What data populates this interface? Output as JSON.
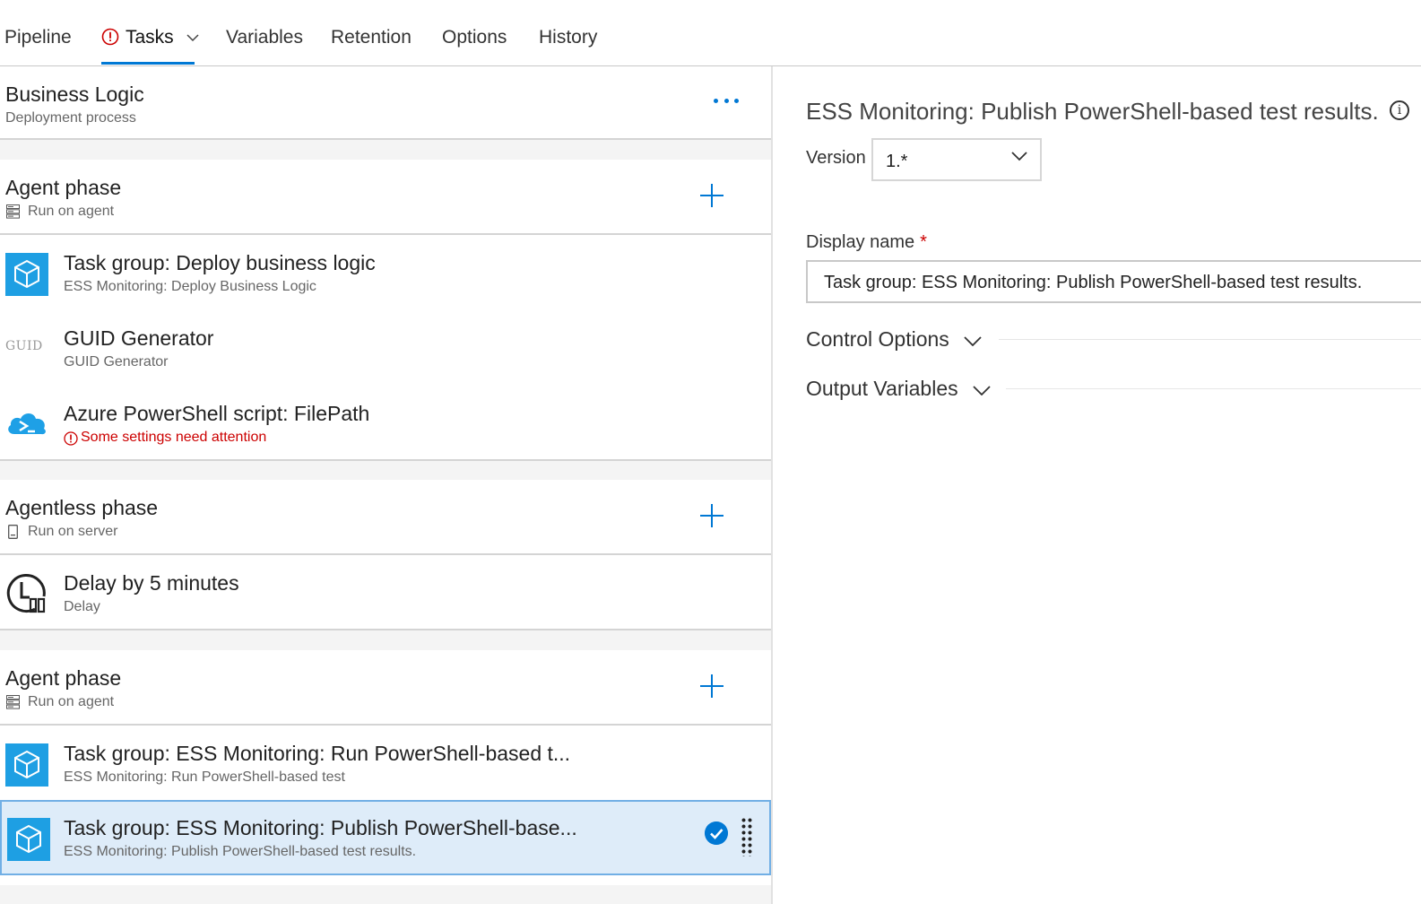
{
  "tabs": {
    "pipeline": "Pipeline",
    "tasks": "Tasks",
    "variables": "Variables",
    "retention": "Retention",
    "options": "Options",
    "history": "History"
  },
  "process": {
    "title": "Business Logic",
    "subtitle": "Deployment process"
  },
  "phases": [
    {
      "title": "Agent phase",
      "subtitle": "Run on agent",
      "tasks": [
        {
          "title": "Task group: Deploy business logic",
          "subtitle": "ESS Monitoring: Deploy Business Logic",
          "icon": "task-group-icon"
        },
        {
          "title": "GUID Generator",
          "subtitle": "GUID Generator",
          "icon": "guid-icon",
          "icon_text": "GUID"
        },
        {
          "title": "Azure PowerShell script: FilePath",
          "subtitle": "Some settings need attention",
          "icon": "azure-powershell-icon"
        }
      ]
    },
    {
      "title": "Agentless phase",
      "subtitle": "Run on server",
      "tasks": [
        {
          "title": "Delay by 5 minutes",
          "subtitle": "Delay",
          "icon": "delay-icon"
        }
      ]
    },
    {
      "title": "Agent phase",
      "subtitle": "Run on agent",
      "tasks": [
        {
          "title": "Task group: ESS Monitoring: Run PowerShell-based t...",
          "subtitle": "ESS Monitoring: Run PowerShell-based test",
          "icon": "task-group-icon"
        },
        {
          "title": "Task group: ESS Monitoring: Publish PowerShell-base...",
          "subtitle": "ESS Monitoring: Publish PowerShell-based test results.",
          "icon": "task-group-icon",
          "selected": true
        }
      ]
    }
  ],
  "details": {
    "heading": "ESS Monitoring: Publish PowerShell-based test results.",
    "version_label": "Version",
    "version_value": "1.*",
    "display_name_label": "Display name",
    "display_name_required": "*",
    "display_name_value": "Task group: ESS Monitoring: Publish PowerShell-based test results.",
    "control_options": "Control Options",
    "output_variables": "Output Variables"
  },
  "colors": {
    "accent": "#0078d4",
    "error": "#cc0000",
    "selected_bg": "#deecf9"
  }
}
